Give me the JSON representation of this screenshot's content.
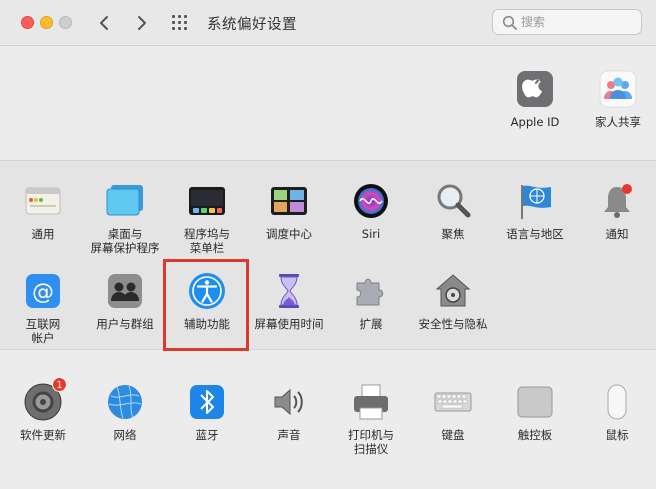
{
  "window": {
    "title": "系统偏好设置",
    "search_placeholder": "搜索"
  },
  "account_items": [
    {
      "label": "Apple ID"
    },
    {
      "label": "家人共享"
    }
  ],
  "personal_items": [
    {
      "label": "通用"
    },
    {
      "label": "桌面与",
      "label2": "屏幕保护程序"
    },
    {
      "label": "程序坞与",
      "label2": "菜单栏"
    },
    {
      "label": "调度中心"
    },
    {
      "label": "Siri"
    },
    {
      "label": "聚焦"
    },
    {
      "label": "语言与地区"
    },
    {
      "label": "通知"
    },
    {
      "label": "互联网",
      "label2": "帐户"
    },
    {
      "label": "用户与群组"
    },
    {
      "label": "辅助功能"
    },
    {
      "label": "屏幕使用时间"
    },
    {
      "label": "扩展"
    },
    {
      "label": "安全性与隐私"
    }
  ],
  "hardware_items": [
    {
      "label": "软件更新",
      "badge": "1"
    },
    {
      "label": "网络"
    },
    {
      "label": "蓝牙"
    },
    {
      "label": "声音"
    },
    {
      "label": "打印机与",
      "label2": "扫描仪"
    },
    {
      "label": "键盘"
    },
    {
      "label": "触控板"
    },
    {
      "label": "鼠标"
    }
  ],
  "colors": {
    "highlight": "#d93a2b",
    "accent": "#1e8ef0"
  }
}
